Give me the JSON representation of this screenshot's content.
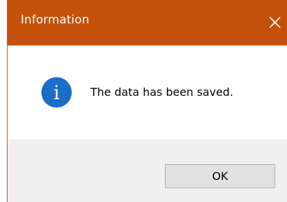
{
  "dialog": {
    "title": "Information",
    "close_icon": "close-icon",
    "icon": "info-icon",
    "icon_glyph": "i",
    "message": "The data has been saved.",
    "ok_label": "OK"
  },
  "colors": {
    "titlebar": "#c4510b",
    "title_text": "#ffffff",
    "info_icon": "#1c6cc9",
    "footer": "#f0f0f0",
    "button_bg": "#e1e1e1",
    "button_border": "#adadad"
  }
}
